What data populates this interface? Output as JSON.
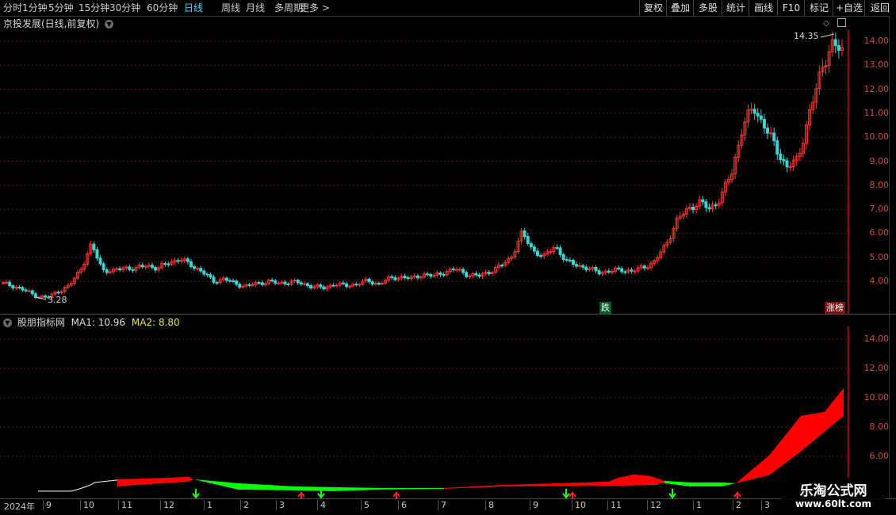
{
  "toolbar": {
    "periods": [
      "分时",
      "1分钟",
      "5分钟",
      "15分钟",
      "30分钟",
      "60分钟",
      "日线",
      "周线",
      "月线",
      "多周期",
      "更多 >"
    ],
    "active_period": "日线",
    "buttons": [
      "复权",
      "叠加",
      "多股",
      "统计",
      "画线",
      "F10",
      "标记",
      "+自选",
      "返回"
    ]
  },
  "main_panel": {
    "title": "京投发展(日线,前复权)",
    "price_axis": [
      "14.00",
      "13.00",
      "12.00",
      "11.00",
      "10.00",
      "9.00",
      "8.00",
      "7.00",
      "6.00",
      "5.00",
      "4.00"
    ],
    "high_label": "14.35",
    "low_label": "3.28",
    "badge_fall": "跌",
    "badge_limit": "涨榜"
  },
  "indicator_panel": {
    "title": "股朋指标网",
    "ma1_label": "MA1: 10.96",
    "ma2_label": "MA2: 8.80",
    "axis": [
      "14.00",
      "12.00",
      "10.00",
      "8.00",
      "6.00"
    ]
  },
  "date_axis": [
    "2024年",
    "9",
    "10",
    "11",
    "12",
    "1",
    "2",
    "3",
    "4",
    "5",
    "6",
    "7",
    "8",
    "9",
    "10",
    "11",
    "12",
    "1",
    "2",
    "3"
  ],
  "watermark": {
    "title": "乐淘公式网",
    "url": "www.60lt.com"
  },
  "colors": {
    "up": "#ff3030",
    "down": "#3fd3d3",
    "ma_up": "#ff0000",
    "ma_down": "#00ff00",
    "grid": "#5a1a1a",
    "active": "#4fd2ff"
  },
  "chart_data": {
    "type": "candlestick",
    "price_range": [
      3.28,
      14.35
    ],
    "closes_approx": [
      3.9,
      3.8,
      3.6,
      3.4,
      3.3,
      3.6,
      3.8,
      4.5,
      5.5,
      4.5,
      4.4,
      4.6,
      4.5,
      4.7,
      4.5,
      4.8,
      4.9,
      4.7,
      4.4,
      4.0,
      4.1,
      3.9,
      3.8,
      3.9,
      4.0,
      3.9,
      4.0,
      3.9,
      3.8,
      3.7,
      3.9,
      3.8,
      3.9,
      4.0,
      3.9,
      4.1,
      4.2,
      4.1,
      4.3,
      4.2,
      4.4,
      4.5,
      4.3,
      4.2,
      4.4,
      4.6,
      5.0,
      6.0,
      5.3,
      5.0,
      5.5,
      4.8,
      4.7,
      4.5,
      4.4,
      4.4,
      4.5,
      4.4,
      4.6,
      4.8,
      5.5,
      6.5,
      7.0,
      7.3,
      7.0,
      7.5,
      8.5,
      10.5,
      11.2,
      10.5,
      9.5,
      8.8,
      9.0,
      11.0,
      12.5,
      14.0,
      13.5
    ],
    "ma_band": {
      "ma1": 10.96,
      "ma2": 8.8
    }
  }
}
